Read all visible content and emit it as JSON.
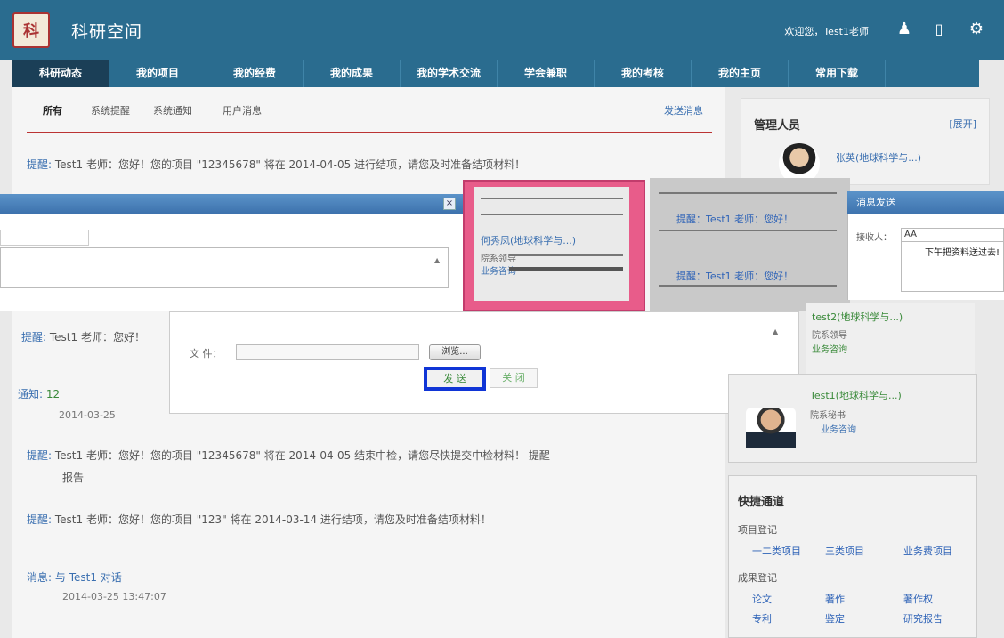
{
  "header": {
    "logo_text": "科",
    "title": "科研空间",
    "welcome": "欢迎您，Test1老师"
  },
  "nav": {
    "items": [
      "科研动态",
      "我的项目",
      "我的经费",
      "我的成果",
      "我的学术交流",
      "学会兼职",
      "我的考核",
      "我的主页",
      "常用下载"
    ]
  },
  "tabs": [
    "所有",
    "系统提醒",
    "系统通知",
    "用户消息"
  ],
  "send_message": "发送消息",
  "notices": [
    {
      "label": "提醒:",
      "text": "Test1 老师：您好！您的项目 \"12345678\" 将在 2014-04-05 进行结项，请您及时准备结项材料！"
    },
    {
      "label": "提醒:",
      "text": "Test1 老师：您好！"
    },
    {
      "label": "通知:",
      "text": "12"
    },
    {
      "label": "",
      "text": "2014-03-25"
    },
    {
      "label": "提醒:",
      "text": "Test1 老师：您好！您的项目 \"12345678\" 将在 2014-04-05 结束中检，请您尽快提交中检材料！ 提醒"
    },
    {
      "label": "",
      "text": "报告"
    },
    {
      "label": "提醒:",
      "text": "Test1 老师：您好！您的项目 \"123\" 将在 2014-03-14 进行结项，请您及时准备结项材料！"
    },
    {
      "label": "消息:",
      "text": "与 Test1 对话"
    },
    {
      "label": "",
      "text": "2014-03-25 13:47:07"
    }
  ],
  "admin": {
    "title": "管理人员",
    "expand": "[展开]",
    "people": [
      {
        "name": "张英(地球科学与...)",
        "role": "",
        "biz": ""
      },
      {
        "name": "何秀凤(地球科学与...)",
        "role": "院系领导",
        "biz": "业务咨询"
      },
      {
        "name": "test2(地球科学与...)",
        "role": "院系领导",
        "biz": "业务咨询"
      },
      {
        "name": "Test1(地球科学与...)",
        "role": "院系秘书",
        "biz": "业务咨询"
      }
    ]
  },
  "strip_notices": [
    "提醒：Test1 老师：您好！",
    "提醒：Test1 老师：您好！"
  ],
  "dialog": {
    "close": "×",
    "file_label": "文 件：",
    "browse": "浏览...",
    "send": "发 送",
    "close_btn": "关 闭"
  },
  "msg_dialog": {
    "title": "消息发送",
    "recipient_label": "接收人：",
    "recipient_value": "AA",
    "body": "下午把资料送过去!"
  },
  "quick": {
    "title": "快捷通道",
    "project_section": "项目登记",
    "project_links": [
      "一二类项目",
      "三类项目",
      "业务费项目"
    ],
    "result_section": "成果登记",
    "result_links": [
      "论文",
      "著作",
      "著作权",
      "专利",
      "鉴定",
      "研究报告"
    ]
  }
}
